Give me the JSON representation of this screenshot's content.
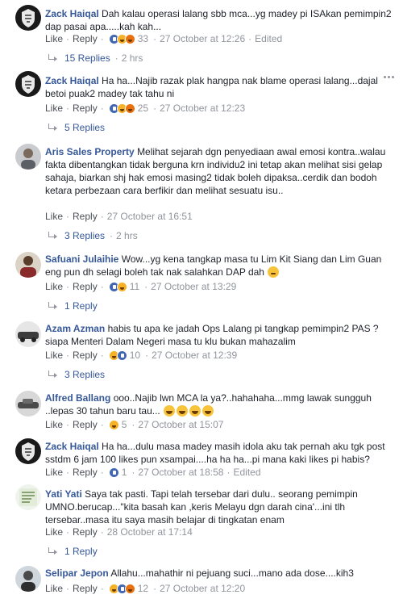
{
  "labels": {
    "like": "Like",
    "reply": "Reply",
    "sep": "·"
  },
  "comments": [
    {
      "name": "Zack Haiqal",
      "text": "Dah kalau operasi lalang sbb mca...yg madey pi ISAkan pemimpin2 dap pasai apa.....kah kah...",
      "count": "33",
      "time": "27 October at 12:26",
      "edited": "Edited",
      "replies": "15 Replies",
      "replies_time": "2 hrs"
    },
    {
      "name": "Zack Haiqal",
      "text": "Ha ha...Najib razak plak hangpa nak blame operasi lalang...dajal betoi puak2 madey tak tahu ni",
      "count": "25",
      "time": "27 October at 12:23",
      "replies": "5 Replies"
    },
    {
      "name": "Aris Sales Property",
      "text": "Melihat sejarah dgn penyediaan awal emosi kontra..walau fakta dibentangkan tidak berguna krn individu2 ini tetap akan melihat sisi gelap sahaja, biarkan shj hak emosi masing2 tidak boleh dipaksa..cerdik dan bodoh ketara perbezaan cara berfikir dan melihat sesuatu isu..",
      "time": "27 October at 16:51",
      "replies": "3 Replies",
      "replies_time": "2 hrs"
    },
    {
      "name": "Safuani Julaihie",
      "text": "Wow...yg kena tangkap masa tu Lim Kit Siang dan Lim Guan eng pun dh selagi boleh tak nak salahkan DAP dah",
      "count": "11",
      "time": "27 October at 13:29",
      "replies": "1 Reply"
    },
    {
      "name": "Azam Azman",
      "text": "habis tu apa ke jadah Ops Lalang pi tangkap pemimpin2 PAS ? siapa Menteri Dalam Negeri masa tu klu bukan mahazalim",
      "count": "10",
      "time": "27 October at 12:39",
      "replies": "3 Replies"
    },
    {
      "name": "Alfred Ballang",
      "text": "ooo..Najib lwn MCA la ya?..hahahaha...mmg lawak sungguh ..lepas 30 tahun baru tau...",
      "count": "5",
      "time": "27 October at 15:07"
    },
    {
      "name": "Zack Haiqal",
      "text": "Ha ha...dulu masa madey masih idola aku tak pernah aku tgk post sstdm 6 jam 100 likes pun xsampai....ha ha ha...pi mana kaki likes pi habis?",
      "count": "1",
      "time": "27 October at 18:58",
      "edited": "Edited"
    },
    {
      "name": "Yati Yati",
      "text": "Saya tak pasti. Tapi telah tersebar dari dulu.. seorang pemimpin UMNO.berucap...\"kita basah kan ,keris Melayu dgn darah cina'...ini tlh tersebar..masa itu saya masih belajar di tingkatan enam",
      "time": "28 October at 17:14",
      "replies": "1 Reply"
    },
    {
      "name": "Selipar Jepon",
      "text": "Allahu...mahathir ni pejuang suci...mano ada dose....kih3",
      "count": "12",
      "time": "27 October at 12:20"
    }
  ],
  "icons": {
    "like_color": "#4267b2",
    "haha_color": "#f7b125",
    "angry_color": "#e9710f",
    "love_color": "#f25268",
    "name_color": "#365899"
  }
}
